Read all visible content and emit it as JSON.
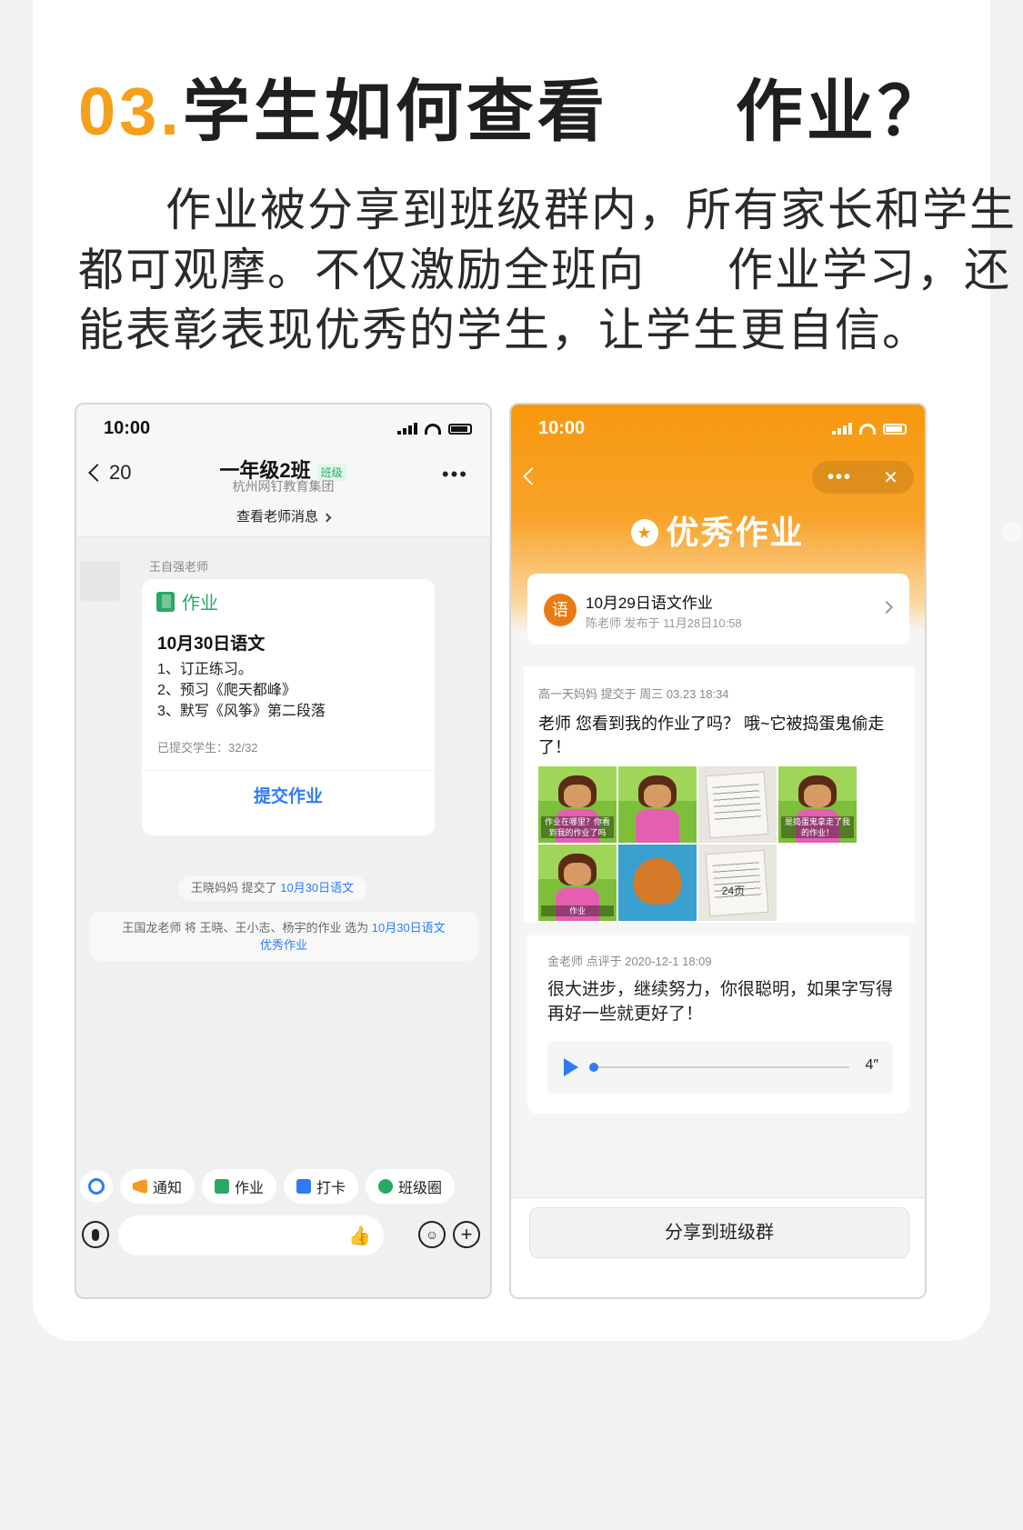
{
  "headline": {
    "number": "03.",
    "part1": "学生如何查看",
    "part2": "作业？"
  },
  "description": {
    "line1": "作业被分享到班级群内，所有家长和学生",
    "line2a": "都可观摩。不仅激励全班向",
    "line2b": "作业学习，还",
    "line3": "能表彰表现优秀的学生，让学生更自信。"
  },
  "left_phone": {
    "status_time": "10:00",
    "back_count": "20",
    "chat_title": "一年级2班",
    "chat_tag": "班级",
    "chat_subtitle": "杭州网钉教育集团",
    "more": "•••",
    "view_teacher_messages": "查看老师消息",
    "sender_name": "王自强老师",
    "homework_card": {
      "tag": "作业",
      "title": "10月30日语文",
      "items": [
        "1、订正练习。",
        "2、预习《爬天都峰》",
        "3、默写《风筝》第二段落"
      ],
      "submitted": "已提交学生：32/32",
      "submit_button": "提交作业"
    },
    "system_msg_1": {
      "prefix": "王晓妈妈 提交了 ",
      "link": "10月30日语文"
    },
    "system_msg_2": {
      "prefix": "王国龙老师 将 王晓、王小志、杨宇的作业 选为 ",
      "link1": "10月30日语文",
      "link2": "优秀作业"
    },
    "toolbar": {
      "notice": "通知",
      "homework": "作业",
      "checkin": "打卡",
      "class_circle": "班级圈"
    },
    "thumb_icon": "👍",
    "emoji_icon": "☺",
    "plus_icon": "+"
  },
  "right_phone": {
    "status_time": "10:00",
    "capsule_more": "•••",
    "capsule_close": "✕",
    "award_title": "优秀作业",
    "info_card": {
      "badge": "语",
      "title": "10月29日语文作业",
      "subtitle": "陈老师 发布于 11月28日10:58"
    },
    "post": {
      "meta": "高一天妈妈  提交于  周三 03.23 18:34",
      "text": "老师 您看到我的作业了吗？ 哦~它被捣蛋鬼偷走了！",
      "photo_captions": [
        "作业在哪里？你看到我的作业了吗",
        "",
        "",
        "",
        "是捣蛋鬼拿走了我的作业！",
        "作业",
        "",
        "24页"
      ]
    },
    "comment": {
      "meta": "金老师  点评于  2020-12-1 18:09",
      "text": "很大进步，继续努力，你很聪明，如果字写得再好一些就更好了！",
      "duration": "4″"
    },
    "share_button": "分享到班级群"
  },
  "colors": {
    "accent_orange": "#f5a01a",
    "link_blue": "#2d7cf6",
    "hw_green": "#2aa866",
    "banner_orange": "#f7990e"
  },
  "icons": [
    "back-chevron-icon",
    "signal-icon",
    "wifi-icon",
    "battery-icon",
    "homework-icon",
    "notice-icon",
    "checkin-icon",
    "class-circle-icon",
    "mic-icon",
    "thumbs-up-icon",
    "emoji-icon",
    "plus-icon",
    "medal-icon",
    "play-icon",
    "close-icon"
  ]
}
